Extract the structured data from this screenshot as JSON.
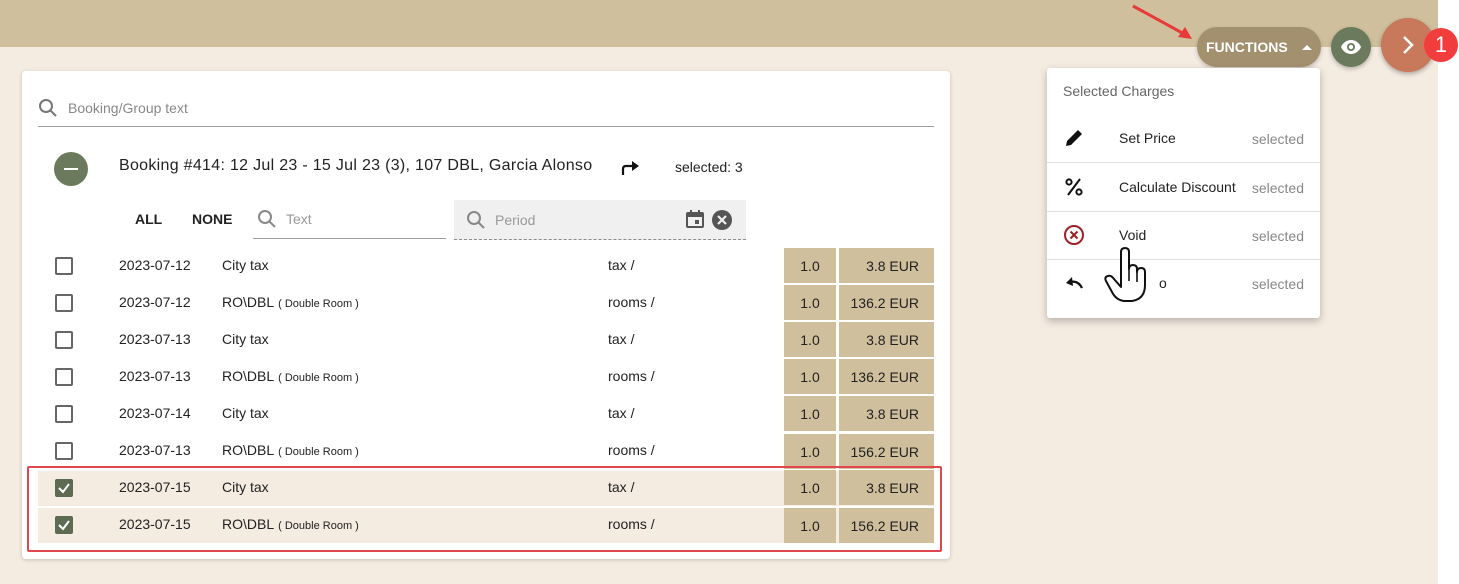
{
  "header": {
    "functions_label": "FUNCTIONS",
    "eye_icon": "eye-icon",
    "next_icon": "chevron-right-icon",
    "badge_count": "1"
  },
  "colors": {
    "topbar": "#cfbf9c",
    "background": "#f4ebe1",
    "functions_button": "#a3906e",
    "eye_button": "#6b7a5c",
    "next_button": "#c9795b",
    "badge": "#f23d3d",
    "highlight_border": "#e0474c",
    "amount_cell": "#cfbf9c"
  },
  "search": {
    "placeholder": "Booking/Group text"
  },
  "booking": {
    "title": "Booking #414: 12 Jul 23 - 15 Jul 23 (3), 107 DBL, Garcia Alonso",
    "selected": "selected: 3"
  },
  "filters": {
    "all": "ALL",
    "none": "NONE",
    "text_placeholder": "Text",
    "period_placeholder": "Period"
  },
  "rows": [
    {
      "checked": false,
      "date": "2023-07-12",
      "desc": "City tax",
      "note": "",
      "cat": "tax /",
      "qty": "1.0",
      "amount": "3.8 EUR"
    },
    {
      "checked": false,
      "date": "2023-07-12",
      "desc": "RO\\DBL",
      "note": "( Double Room )",
      "cat": "rooms /",
      "qty": "1.0",
      "amount": "136.2 EUR"
    },
    {
      "checked": false,
      "date": "2023-07-13",
      "desc": "City tax",
      "note": "",
      "cat": "tax /",
      "qty": "1.0",
      "amount": "3.8 EUR"
    },
    {
      "checked": false,
      "date": "2023-07-13",
      "desc": "RO\\DBL",
      "note": "( Double Room )",
      "cat": "rooms /",
      "qty": "1.0",
      "amount": "136.2 EUR"
    },
    {
      "checked": false,
      "date": "2023-07-14",
      "desc": "City tax",
      "note": "",
      "cat": "tax /",
      "qty": "1.0",
      "amount": "3.8 EUR"
    },
    {
      "checked": false,
      "date": "2023-07-13",
      "desc": "RO\\DBL",
      "note": "( Double Room )",
      "cat": "rooms /",
      "qty": "1.0",
      "amount": "156.2 EUR"
    },
    {
      "checked": true,
      "date": "2023-07-15",
      "desc": "City tax",
      "note": "",
      "cat": "tax /",
      "qty": "1.0",
      "amount": "3.8 EUR"
    },
    {
      "checked": true,
      "date": "2023-07-15",
      "desc": "RO\\DBL",
      "note": "( Double Room )",
      "cat": "rooms /",
      "qty": "1.0",
      "amount": "156.2 EUR"
    }
  ],
  "menu": {
    "header": "Selected Charges",
    "items": [
      {
        "label": "Set Price",
        "status": "selected",
        "icon": "pencil-icon"
      },
      {
        "label": "Calculate Discount",
        "status": "selected",
        "icon": "percent-icon"
      },
      {
        "label": "Void",
        "status": "selected",
        "icon": "void-circle-x-icon"
      },
      {
        "label": "o",
        "status": "selected",
        "icon": "undo-icon"
      }
    ]
  }
}
